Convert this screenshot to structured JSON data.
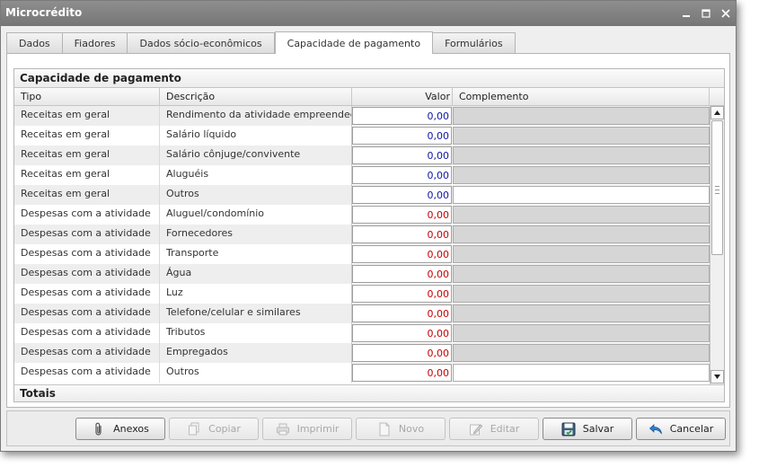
{
  "window": {
    "title": "Microcrédito"
  },
  "tabs": [
    {
      "label": "Dados",
      "active": false
    },
    {
      "label": "Fiadores",
      "active": false
    },
    {
      "label": "Dados sócio-econômicos",
      "active": false
    },
    {
      "label": "Capacidade de pagamento",
      "active": true
    },
    {
      "label": "Formulários",
      "active": false
    }
  ],
  "section": {
    "title": "Capacidade de pagamento",
    "columns": {
      "tipo": "Tipo",
      "descricao": "Descrição",
      "valor": "Valor",
      "complemento": "Complemento"
    },
    "rows": [
      {
        "tipo": "Receitas em geral",
        "descricao": "Rendimento da atividade empreendedora",
        "valor": "0,00",
        "kind": "receita",
        "complemento": "",
        "complemento_enabled": false
      },
      {
        "tipo": "Receitas em geral",
        "descricao": "Salário líquido",
        "valor": "0,00",
        "kind": "receita",
        "complemento": "",
        "complemento_enabled": false
      },
      {
        "tipo": "Receitas em geral",
        "descricao": "Salário cônjuge/convivente",
        "valor": "0,00",
        "kind": "receita",
        "complemento": "",
        "complemento_enabled": false
      },
      {
        "tipo": "Receitas em geral",
        "descricao": "Aluguéis",
        "valor": "0,00",
        "kind": "receita",
        "complemento": "",
        "complemento_enabled": false
      },
      {
        "tipo": "Receitas em geral",
        "descricao": "Outros",
        "valor": "0,00",
        "kind": "receita",
        "complemento": "",
        "complemento_enabled": true
      },
      {
        "tipo": "Despesas com a atividade",
        "descricao": "Aluguel/condomínio",
        "valor": "0,00",
        "kind": "despesa",
        "complemento": "",
        "complemento_enabled": false
      },
      {
        "tipo": "Despesas com a atividade",
        "descricao": "Fornecedores",
        "valor": "0,00",
        "kind": "despesa",
        "complemento": "",
        "complemento_enabled": false
      },
      {
        "tipo": "Despesas com a atividade",
        "descricao": "Transporte",
        "valor": "0,00",
        "kind": "despesa",
        "complemento": "",
        "complemento_enabled": false
      },
      {
        "tipo": "Despesas com a atividade",
        "descricao": "Água",
        "valor": "0,00",
        "kind": "despesa",
        "complemento": "",
        "complemento_enabled": false
      },
      {
        "tipo": "Despesas com a atividade",
        "descricao": "Luz",
        "valor": "0,00",
        "kind": "despesa",
        "complemento": "",
        "complemento_enabled": false
      },
      {
        "tipo": "Despesas com a atividade",
        "descricao": "Telefone/celular e similares",
        "valor": "0,00",
        "kind": "despesa",
        "complemento": "",
        "complemento_enabled": false
      },
      {
        "tipo": "Despesas com a atividade",
        "descricao": "Tributos",
        "valor": "0,00",
        "kind": "despesa",
        "complemento": "",
        "complemento_enabled": false
      },
      {
        "tipo": "Despesas com a atividade",
        "descricao": "Empregados",
        "valor": "0,00",
        "kind": "despesa",
        "complemento": "",
        "complemento_enabled": false
      },
      {
        "tipo": "Despesas com a atividade",
        "descricao": "Outros",
        "valor": "0,00",
        "kind": "despesa",
        "complemento": "",
        "complemento_enabled": true
      }
    ],
    "totals_label": "Totais"
  },
  "buttons": [
    {
      "label": "Anexos",
      "icon": "paperclip-icon",
      "enabled": true
    },
    {
      "label": "Copiar",
      "icon": "copy-icon",
      "enabled": false
    },
    {
      "label": "Imprimir",
      "icon": "printer-icon",
      "enabled": false
    },
    {
      "label": "Novo",
      "icon": "new-document-icon",
      "enabled": false
    },
    {
      "label": "Editar",
      "icon": "pencil-icon",
      "enabled": false
    },
    {
      "label": "Salvar",
      "icon": "save-icon",
      "enabled": true
    },
    {
      "label": "Cancelar",
      "icon": "undo-arrow-icon",
      "enabled": true
    }
  ],
  "colors": {
    "receita_value": "#0b16a6",
    "despesa_value": "#c60000",
    "titlebar": "#808080"
  }
}
